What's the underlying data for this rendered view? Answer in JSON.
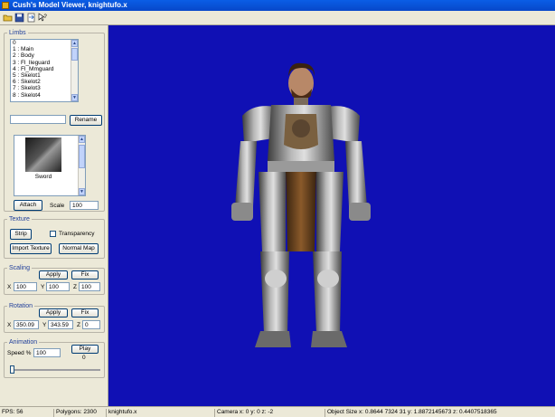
{
  "window": {
    "title": "Cush's Model Viewer, knightufo.x"
  },
  "toolbar": {
    "icons": [
      "open-icon",
      "save-icon",
      "export-icon",
      "help-icon"
    ]
  },
  "limbs": {
    "title": "Limbs",
    "items": [
      "0",
      "1 : Main",
      "2 : Body",
      "3 : Fl_lleguard",
      "4 : Fl_Mmguard",
      "5 : Skelot1",
      "6 : Skelot2",
      "7 : Skelot3",
      "8 : Skelot4"
    ],
    "rename_value": "",
    "rename_label": "Rename",
    "preview_label": "Sword",
    "attach_label": "Attach",
    "scale_label": "Scale",
    "scale_value": "100"
  },
  "texture": {
    "title": "Texture",
    "strip_label": "Strip",
    "transparency_label": "Transparency",
    "import_label": "Import Texture",
    "normal_map_label": "Normal Map"
  },
  "scaling": {
    "title": "Scaling",
    "apply_label": "Apply",
    "fix_label": "Fix",
    "x_label": "X",
    "x_value": "100",
    "y_label": "Y",
    "y_value": "100",
    "z_label": "Z",
    "z_value": "100"
  },
  "rotation": {
    "title": "Rotation",
    "apply_label": "Apply",
    "fix_label": "Fix",
    "x_label": "X",
    "x_value": "350.09",
    "y_label": "Y",
    "y_value": "343.59",
    "z_label": "Z",
    "z_value": "0"
  },
  "animation": {
    "title": "Animation",
    "speed_label": "Speed %",
    "speed_value": "100",
    "play_label": "Play",
    "frame_value": "0",
    "slider_position": 0.0
  },
  "status": {
    "fps": "FPS: 56",
    "polygons": "Polygons: 2300",
    "file": "knightufo.x",
    "camera": "Camera   x: 0   y: 0   z: -2",
    "object": "Object Size   x: 0.8644 7324 31   y: 1.8872145673   z: 0.4407518365"
  },
  "colors": {
    "viewport_bg": "#1010b4",
    "titlebar": "#0a5ee6"
  }
}
